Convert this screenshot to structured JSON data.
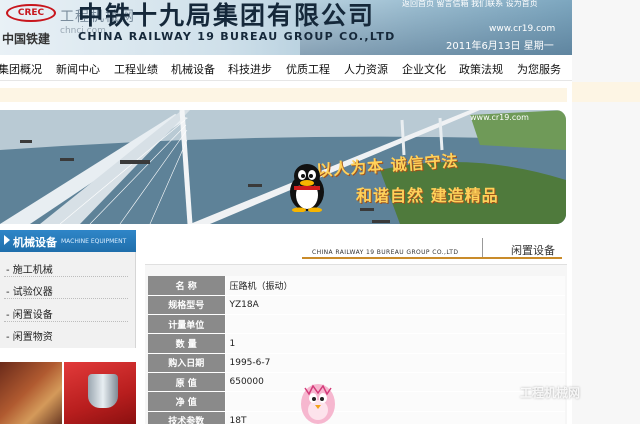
{
  "header": {
    "logo_mark": "CREC",
    "logo_cn": "中国铁建",
    "site_cn": "工程机械网",
    "site_pinyin": "chnci.com",
    "company_cn": "中铁十九局集团有限公司",
    "company_en": "CHINA RAILWAY 19 BUREAU GROUP CO.,LTD",
    "top_links": "返回首页  留言信箱  我们联系  设为首页",
    "url": "www.cr19.com",
    "date": "2011年6月13日 星期一"
  },
  "nav": {
    "items": [
      "集团概况",
      "新闻中心",
      "工程业绩",
      "机械设备",
      "科技进步",
      "优质工程",
      "人力资源",
      "企业文化",
      "政策法规",
      "为您服务"
    ]
  },
  "banner": {
    "url": "www.cr19.com",
    "slogan1": "以人为本  诚信守法",
    "slogan2": "和谐自然  建造精品"
  },
  "sidebar": {
    "title": "机械设备",
    "title_en": "MACHINE EQUIPMENT",
    "items": [
      "施工机械",
      "试验仪器",
      "闲置设备",
      "闲置物资"
    ]
  },
  "content": {
    "header_en": "CHINA RAILWAY 19 BUREAU GROUP CO.,LTD",
    "header_zh": "闲置设备",
    "rows": [
      {
        "label": "名    称",
        "value": "压路机（振动）"
      },
      {
        "label": "规格型号",
        "value": "YZ18A"
      },
      {
        "label": "计量单位",
        "value": ""
      },
      {
        "label": "数    量",
        "value": "1"
      },
      {
        "label": "购入日期",
        "value": "1995-6-7"
      },
      {
        "label": "原    值",
        "value": "650000"
      },
      {
        "label": "净    值",
        "value": ""
      },
      {
        "label": "技术参数",
        "value": "18T"
      }
    ]
  },
  "watermark": "工程机械网",
  "colors": {
    "accent_blue": "#1f6eab",
    "accent_gold": "#c98b2a",
    "label_gray": "#8a8a8a",
    "brand_red": "#c8161d"
  }
}
